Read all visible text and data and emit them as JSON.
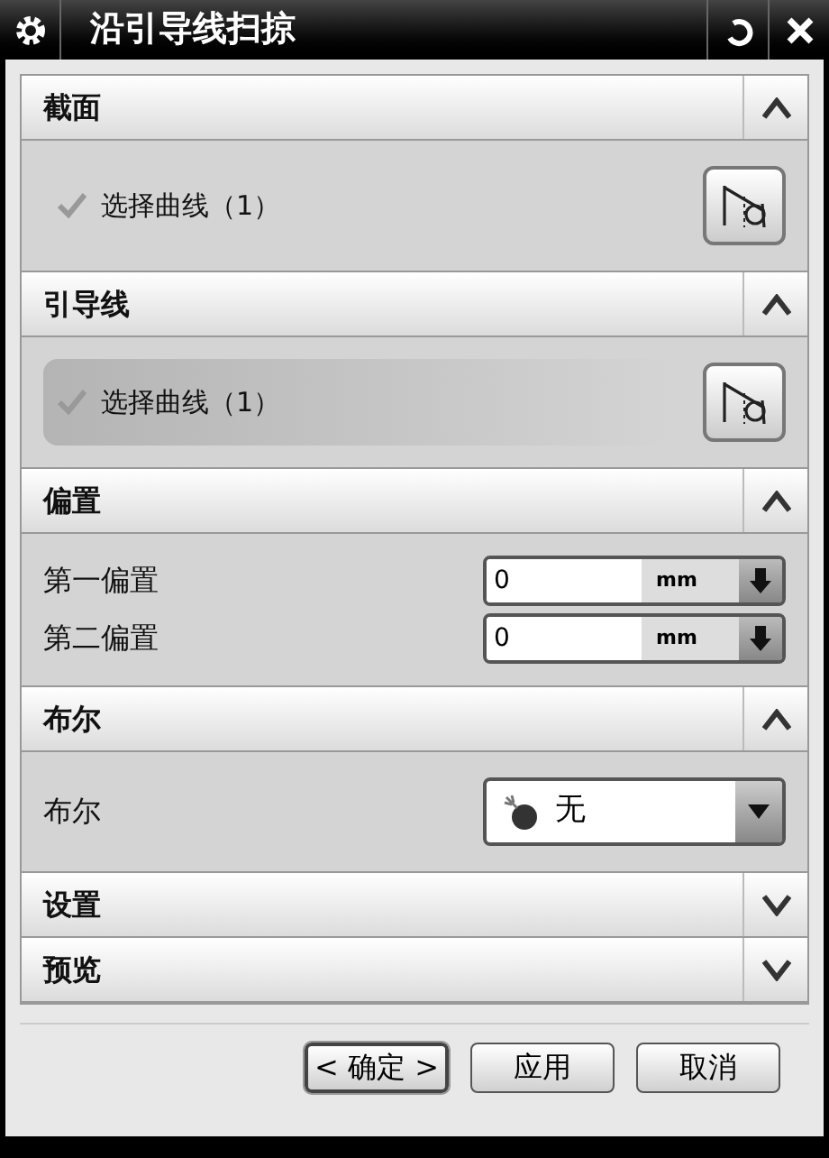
{
  "window": {
    "title": "沿引导线扫掠"
  },
  "sections": [
    {
      "title": "截面",
      "expanded": true,
      "kind": "selection",
      "label": "选择曲线（1）",
      "selected": false
    },
    {
      "title": "引导线",
      "expanded": true,
      "kind": "selection",
      "label": "选择曲线（1）",
      "selected": true
    },
    {
      "title": "偏置",
      "expanded": true,
      "kind": "offsets",
      "rows": [
        {
          "label": "第一偏置",
          "value": "0",
          "unit": "mm"
        },
        {
          "label": "第二偏置",
          "value": "0",
          "unit": "mm"
        }
      ]
    },
    {
      "title": "布尔",
      "expanded": true,
      "kind": "dropdown",
      "label": "布尔",
      "value": "无"
    },
    {
      "title": "设置",
      "expanded": false
    },
    {
      "title": "预览",
      "expanded": false
    }
  ],
  "buttons": [
    {
      "label": "< 确定 >",
      "default": true
    },
    {
      "label": "应用",
      "default": false
    },
    {
      "label": "取消",
      "default": false
    }
  ]
}
